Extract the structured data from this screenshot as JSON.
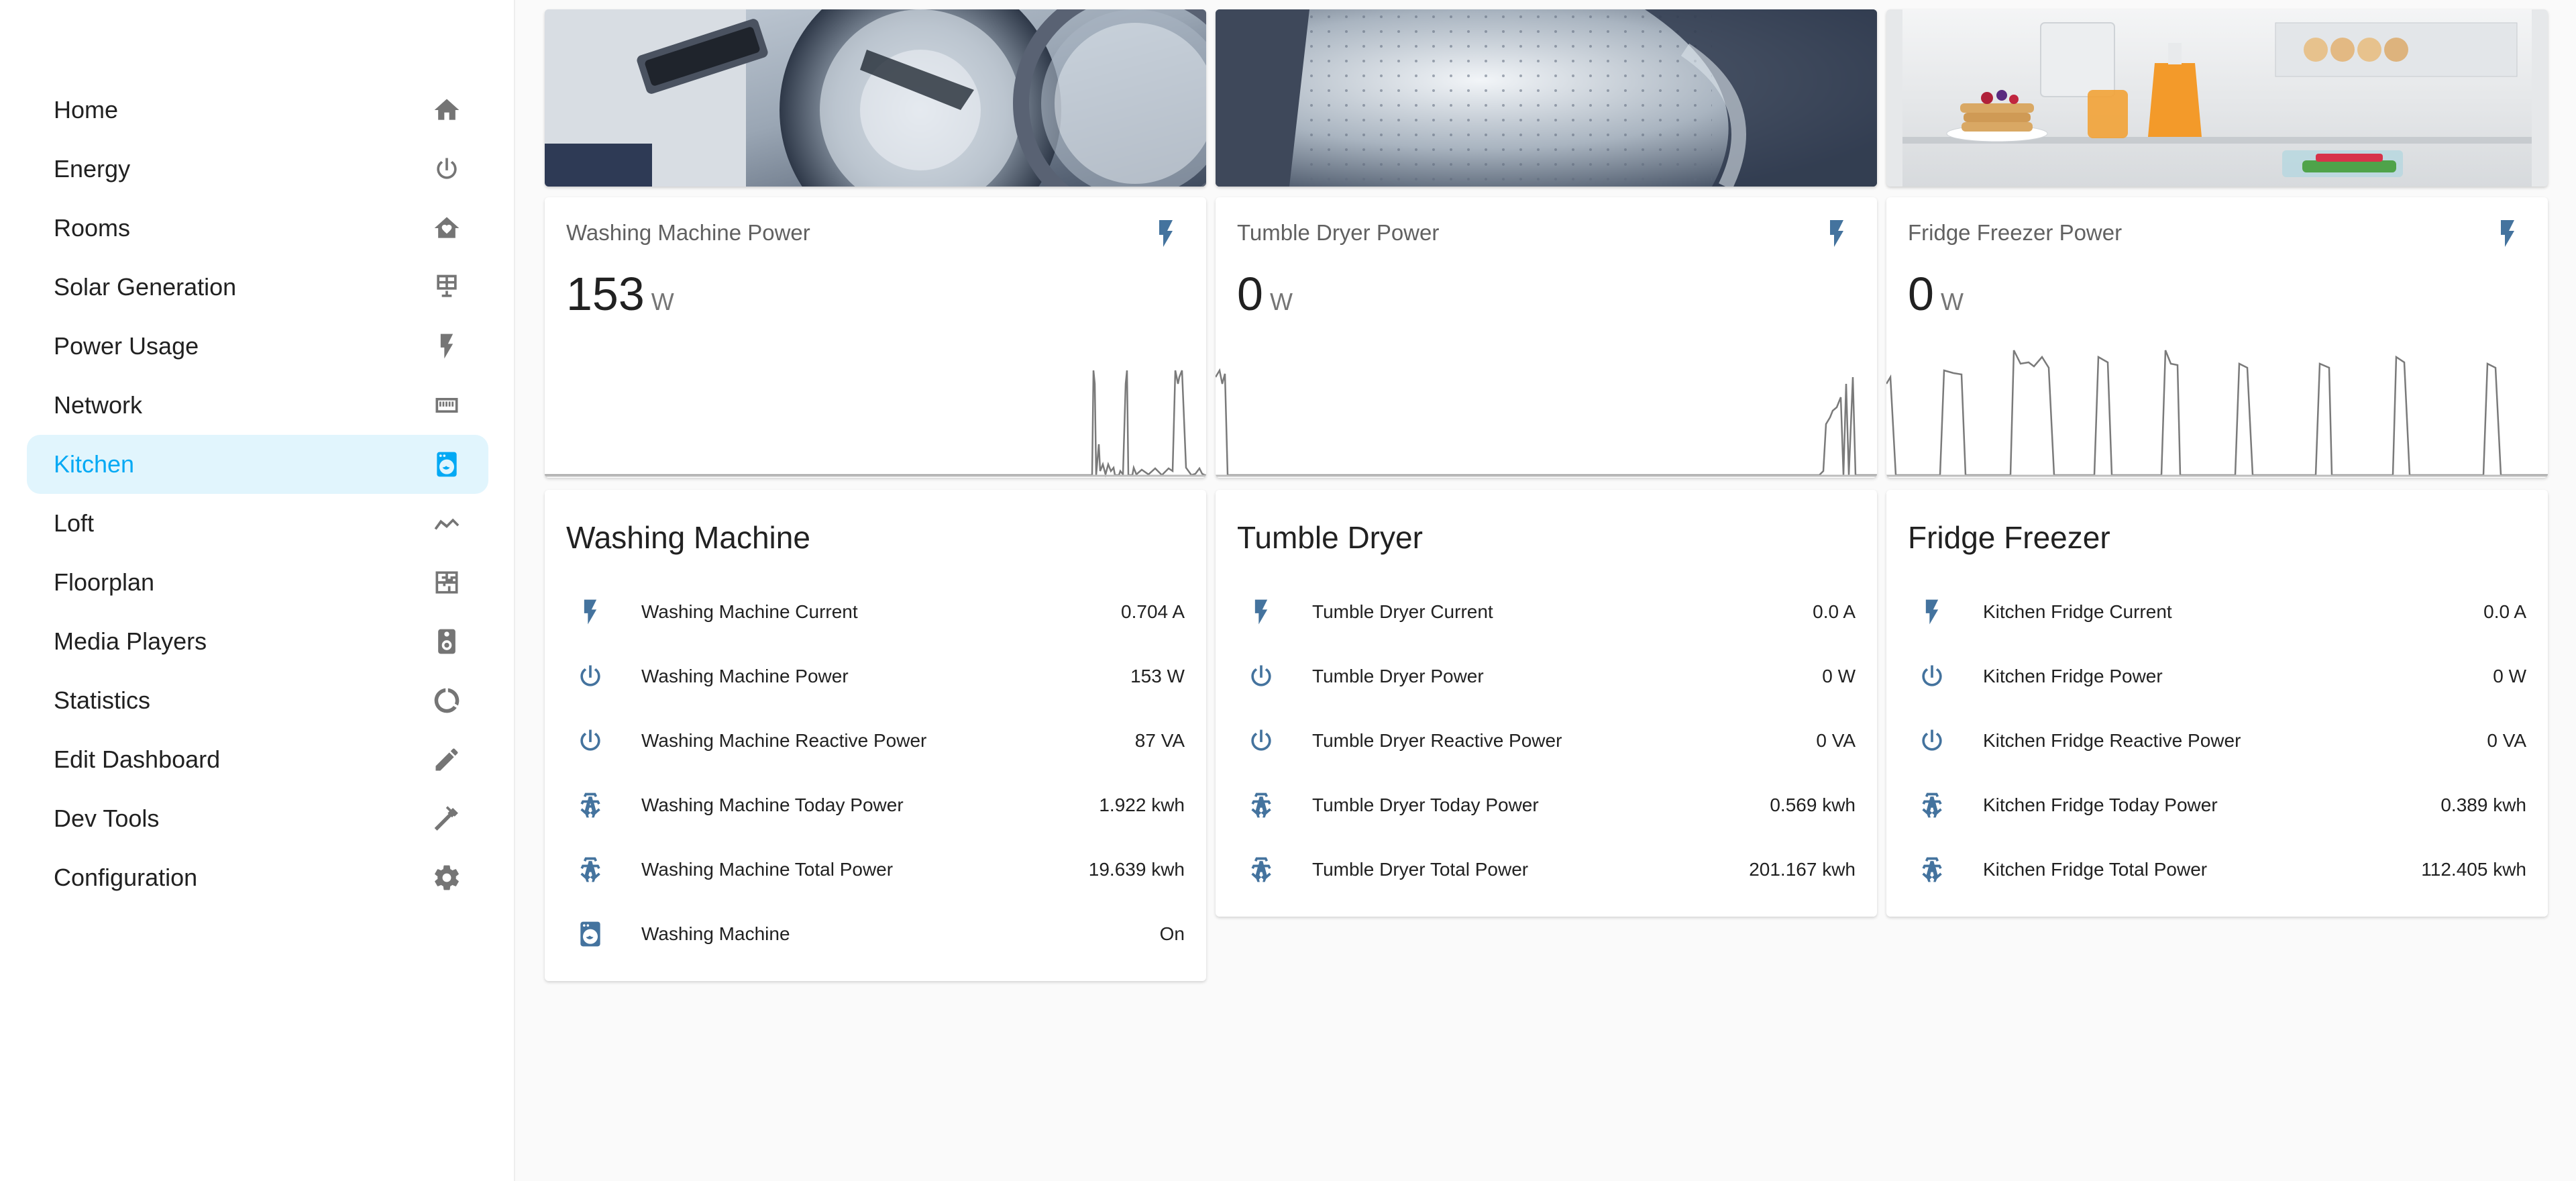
{
  "sidebar": {
    "items": [
      {
        "label": "Home",
        "icon": "home-icon",
        "active": false
      },
      {
        "label": "Energy",
        "icon": "power-icon",
        "active": false
      },
      {
        "label": "Rooms",
        "icon": "home-heart-icon",
        "active": false
      },
      {
        "label": "Solar Generation",
        "icon": "solar-panel-icon",
        "active": false
      },
      {
        "label": "Power Usage",
        "icon": "flash-icon",
        "active": false
      },
      {
        "label": "Network",
        "icon": "ethernet-icon",
        "active": false
      },
      {
        "label": "Kitchen",
        "icon": "washing-machine-icon",
        "active": true
      },
      {
        "label": "Loft",
        "icon": "loft-icon",
        "active": false
      },
      {
        "label": "Floorplan",
        "icon": "floorplan-icon",
        "active": false
      },
      {
        "label": "Media Players",
        "icon": "speaker-icon",
        "active": false
      },
      {
        "label": "Statistics",
        "icon": "chart-donut-icon",
        "active": false
      },
      {
        "label": "Edit Dashboard",
        "icon": "pencil-icon",
        "active": false
      },
      {
        "label": "Dev Tools",
        "icon": "hammer-icon",
        "active": false
      },
      {
        "label": "Configuration",
        "icon": "cog-icon",
        "active": false
      }
    ]
  },
  "colors": {
    "accent": "#03a9f4",
    "active_bg": "#e1f5fd",
    "entity_icon": "#44739e",
    "sidebar_icon": "#757575"
  },
  "sensors": [
    {
      "name": "Washing Machine Power",
      "value": "153",
      "unit": "W"
    },
    {
      "name": "Tumble Dryer Power",
      "value": "0",
      "unit": "W"
    },
    {
      "name": "Fridge Freezer Power",
      "value": "0",
      "unit": "W"
    }
  ],
  "entity_cards": [
    {
      "title": "Washing Machine",
      "rows": [
        {
          "icon": "flash-icon",
          "label": "Washing Machine Current",
          "value": "0.704 A"
        },
        {
          "icon": "power-icon",
          "label": "Washing Machine Power",
          "value": "153 W"
        },
        {
          "icon": "power-icon",
          "label": "Washing Machine Reactive Power",
          "value": "87 VA"
        },
        {
          "icon": "transmission-tower-icon",
          "label": "Washing Machine Today Power",
          "value": "1.922 kwh"
        },
        {
          "icon": "transmission-tower-icon",
          "label": "Washing Machine Total Power",
          "value": "19.639 kwh"
        },
        {
          "icon": "washing-machine-icon",
          "label": "Washing Machine",
          "value": "On"
        }
      ]
    },
    {
      "title": "Tumble Dryer",
      "rows": [
        {
          "icon": "flash-icon",
          "label": "Tumble Dryer Current",
          "value": "0.0 A"
        },
        {
          "icon": "power-icon",
          "label": "Tumble Dryer Power",
          "value": "0 W"
        },
        {
          "icon": "power-icon",
          "label": "Tumble Dryer Reactive Power",
          "value": "0 VA"
        },
        {
          "icon": "transmission-tower-icon",
          "label": "Tumble Dryer Today Power",
          "value": "0.569 kwh"
        },
        {
          "icon": "transmission-tower-icon",
          "label": "Tumble Dryer Total Power",
          "value": "201.167 kwh"
        }
      ]
    },
    {
      "title": "Fridge Freezer",
      "rows": [
        {
          "icon": "flash-icon",
          "label": "Kitchen Fridge Current",
          "value": "0.0 A"
        },
        {
          "icon": "power-icon",
          "label": "Kitchen Fridge Power",
          "value": "0 W"
        },
        {
          "icon": "power-icon",
          "label": "Kitchen Fridge Reactive Power",
          "value": "0 VA"
        },
        {
          "icon": "transmission-tower-icon",
          "label": "Kitchen Fridge Today Power",
          "value": "0.389 kwh"
        },
        {
          "icon": "transmission-tower-icon",
          "label": "Kitchen Fridge Total Power",
          "value": "112.405 kwh"
        }
      ]
    }
  ]
}
